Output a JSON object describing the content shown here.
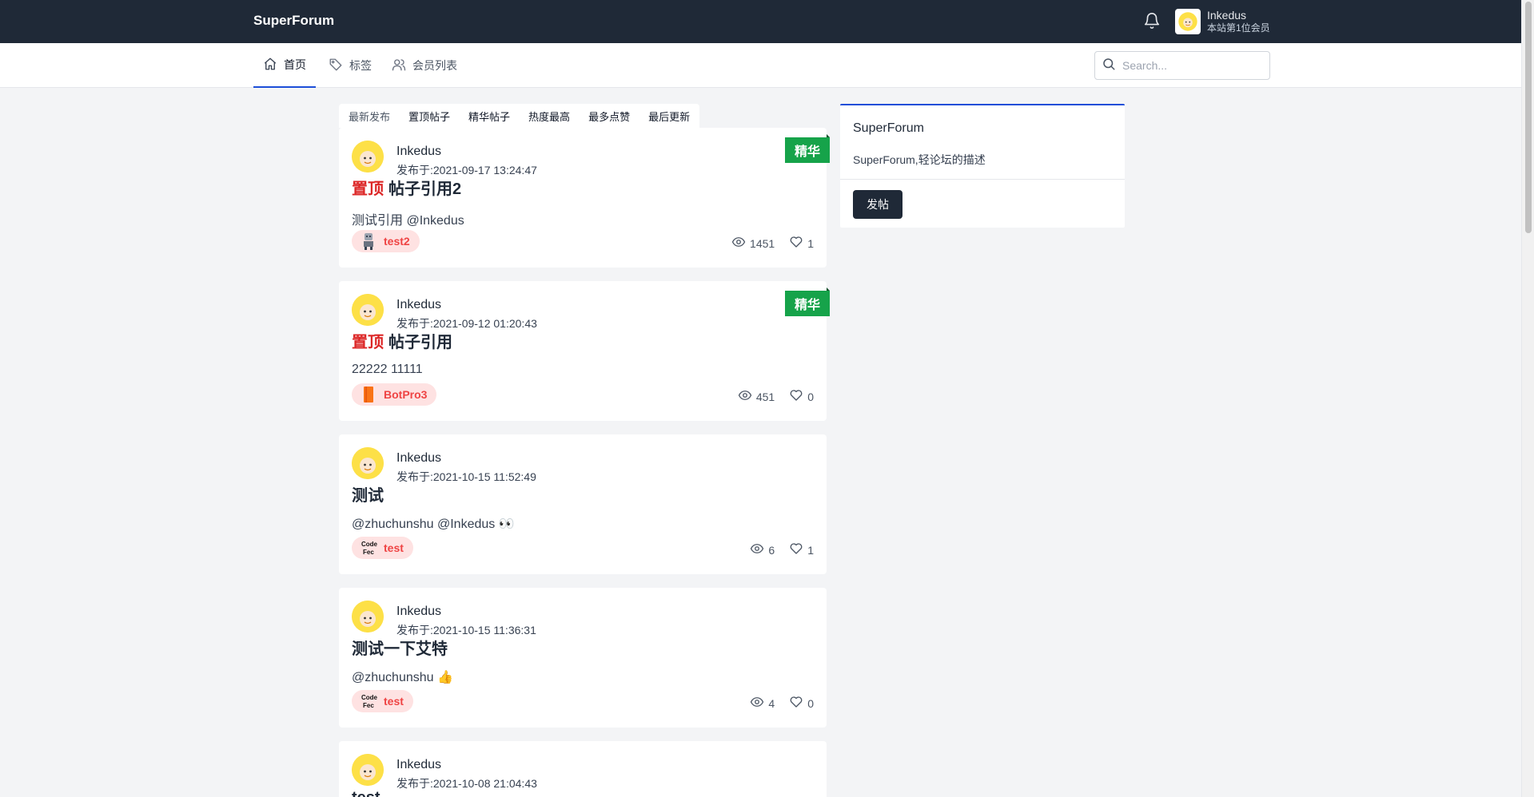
{
  "header": {
    "brand": "SuperForum",
    "user_name": "Inkedus",
    "user_rank": "本站第1位会员"
  },
  "nav": {
    "items": [
      {
        "label": "首页",
        "icon": "home-icon",
        "active": true
      },
      {
        "label": "标签",
        "icon": "tag-icon",
        "active": false
      },
      {
        "label": "会员列表",
        "icon": "users-icon",
        "active": false
      }
    ],
    "search_placeholder": "Search..."
  },
  "sort_tabs": [
    "最新发布",
    "置顶帖子",
    "精华帖子",
    "热度最高",
    "最多点赞",
    "最后更新"
  ],
  "posts": [
    {
      "author": "Inkedus",
      "date": "发布于:2021-09-17 13:24:47",
      "pin": "置顶",
      "title": "帖子引用2",
      "excerpt": "测试引用 @Inkedus",
      "tag": "test2",
      "tag_icon": "robot-avatar-icon",
      "views": "1451",
      "likes": "1",
      "featured": "精华"
    },
    {
      "author": "Inkedus",
      "date": "发布于:2021-09-12 01:20:43",
      "pin": "置顶",
      "title": "帖子引用",
      "excerpt": "22222 11111",
      "tag": "BotPro3",
      "tag_icon": "orange-book-icon",
      "views": "451",
      "likes": "0",
      "featured": "精华"
    },
    {
      "author": "Inkedus",
      "date": "发布于:2021-10-15 11:52:49",
      "pin": "",
      "title": "测试",
      "excerpt": "@zhuchunshu @Inkedus 👀",
      "tag": "test",
      "tag_icon": "codefec-logo-icon",
      "views": "6",
      "likes": "1",
      "featured": ""
    },
    {
      "author": "Inkedus",
      "date": "发布于:2021-10-15 11:36:31",
      "pin": "",
      "title": "测试一下艾特",
      "excerpt": "@zhuchunshu 👍",
      "tag": "test",
      "tag_icon": "codefec-logo-icon",
      "views": "4",
      "likes": "0",
      "featured": ""
    },
    {
      "author": "Inkedus",
      "date": "发布于:2021-10-08 21:04:43",
      "pin": "",
      "title": "test",
      "excerpt": "",
      "tag": "",
      "tag_icon": "",
      "views": "",
      "likes": "",
      "featured": ""
    }
  ],
  "sidebar": {
    "title": "SuperForum",
    "description": "SuperForum,轻论坛的描述",
    "button": "发帖"
  },
  "colors": {
    "topbar": "#1f2937",
    "accent": "#1d4ed8",
    "pin": "#dc2626",
    "featured": "#16a34a",
    "tag_text": "#ef4444"
  }
}
